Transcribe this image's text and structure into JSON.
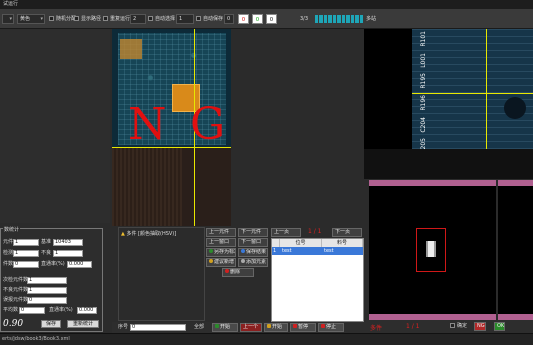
{
  "window": {
    "title": "试运行"
  },
  "toolbar": {
    "drop1": "",
    "drop2": "黄色",
    "check_random": "随机分配",
    "check_show_path": "显示路径",
    "repeat_label": "重复运行",
    "repeat_value": "2",
    "auto_select_label": "自动选择",
    "auto_select_value": "1",
    "auto_save_label": "自动保存",
    "auto_save_value": "0",
    "count_red": "0",
    "count_green": "0",
    "count_black": "0",
    "progress_text": "3/3",
    "progress_segments": 11,
    "multi_label": "多站",
    "colors": {
      "progress": "#1ea6b8",
      "ng": "#e01010",
      "crosshair": "#e8e800"
    }
  },
  "main_image": {
    "ng_left": "N",
    "ng_right": "G"
  },
  "right_image": {
    "labels": [
      "R101",
      "L001",
      "R195",
      "R196",
      "C204",
      "C205"
    ]
  },
  "stats": {
    "title": "数统计",
    "rows": [
      {
        "label": "元件",
        "value": "1"
      },
      {
        "label": "检测",
        "value": "1"
      },
      {
        "label": "件数",
        "value": "0"
      }
    ],
    "right_rows": [
      {
        "label": "基准",
        "value": "10403"
      },
      {
        "label": "不良",
        "value": "1"
      },
      {
        "label": "直通率(%)",
        "value": "0.000"
      }
    ],
    "lower_rows": [
      {
        "label": "次检元件数",
        "value": "1"
      },
      {
        "label": "不良元件数",
        "value": "1"
      },
      {
        "label": "误报元件数",
        "value": "0"
      },
      {
        "label": "平均数",
        "value": "0"
      }
    ],
    "rate_label": "直通率(%)",
    "rate_value": "0.000",
    "big_value": "0.90",
    "save_button": "保存",
    "reset_button": "重新统计"
  },
  "info": {
    "header": "多件 [颜色抽取(HSV)]",
    "serial_label": "序号",
    "serial_value": "0",
    "all_label": "全部"
  },
  "buttons": {
    "prev_component": "上一元件",
    "next_component": "下一元件",
    "prev_page": "上一页",
    "next_page": "下一页",
    "prev_window": "上一窗口",
    "next_window": "下一窗口",
    "page_indicator": "1 / 1",
    "save_shape": "另存为标准",
    "save_result": "保存结果",
    "add_template": "建议新增",
    "add_image": "添加元素",
    "delete": "删除"
  },
  "table": {
    "col1": "位号",
    "col2": "料号",
    "row_index": "1",
    "row_col1": "test",
    "row_col2": "test"
  },
  "actions": {
    "start": "开始",
    "pause": "暂停",
    "stop": "停止",
    "prev": "上一个",
    "next": "下一个"
  },
  "thumbs": {
    "label_multi": "多件",
    "page": "1 / 1",
    "confirm": "确定",
    "ng_label": "NG",
    "ok_label": "OK"
  },
  "status": {
    "path": "erts/jdsw/book3/Book3.xml"
  }
}
